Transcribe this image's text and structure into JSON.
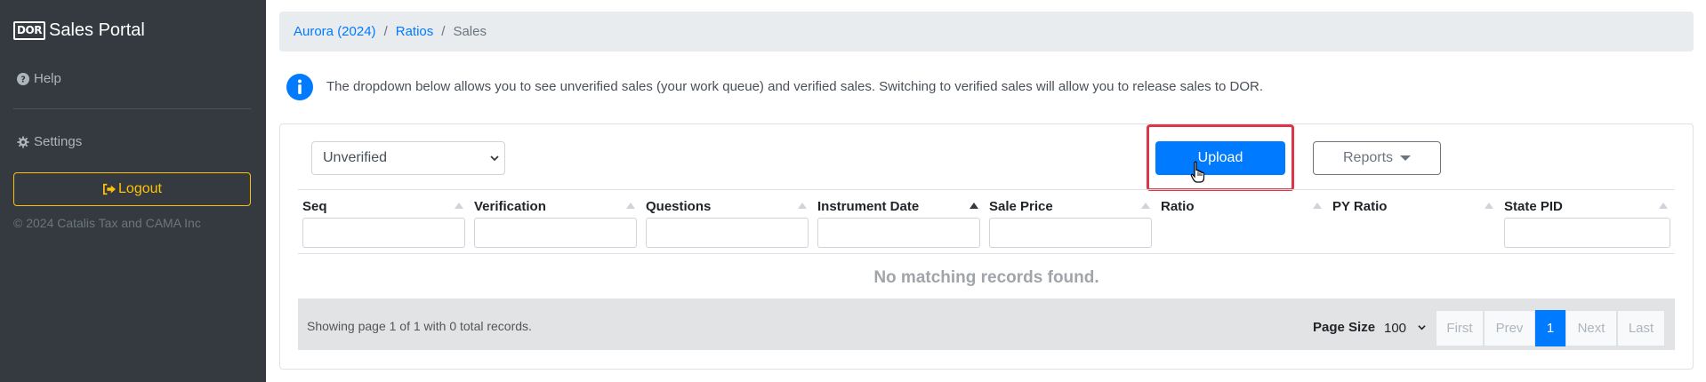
{
  "sidebar": {
    "brand_logo": "DOR",
    "brand_title": "Sales Portal",
    "help_label": "Help",
    "settings_label": "Settings",
    "logout_label": "Logout",
    "copyright": "© 2024 Catalis Tax and CAMA Inc"
  },
  "breadcrumb": {
    "items": [
      "Aurora (2024)",
      "Ratios"
    ],
    "active": "Sales",
    "separator": "/"
  },
  "info": {
    "message": "The dropdown below allows you to see unverified sales (your work queue) and verified sales. Switching to verified sales will allow you to release sales to DOR."
  },
  "toolbar": {
    "filter_selected": "Unverified",
    "upload_label": "Upload",
    "reports_label": "Reports"
  },
  "table": {
    "columns": [
      "Seq",
      "Verification",
      "Questions",
      "Instrument Date",
      "Sale Price",
      "Ratio",
      "PY Ratio",
      "State PID"
    ],
    "empty_message": "No matching records found."
  },
  "footer": {
    "summary": "Showing page 1 of 1 with 0 total records.",
    "page_size_label": "Page Size",
    "page_size_value": "100",
    "pager": [
      "First",
      "Prev",
      "1",
      "Next",
      "Last"
    ]
  },
  "colors": {
    "sidebar_bg": "#343a40",
    "primary": "#007bff",
    "warning": "#ffc107",
    "highlight": "#dc3545"
  },
  "icons": {
    "help": "question-circle-icon",
    "settings": "gear-icon",
    "logout": "sign-out-icon",
    "info": "info-circle-icon",
    "sort": "sort-up-icon",
    "cursor": "hand-pointer-icon"
  }
}
